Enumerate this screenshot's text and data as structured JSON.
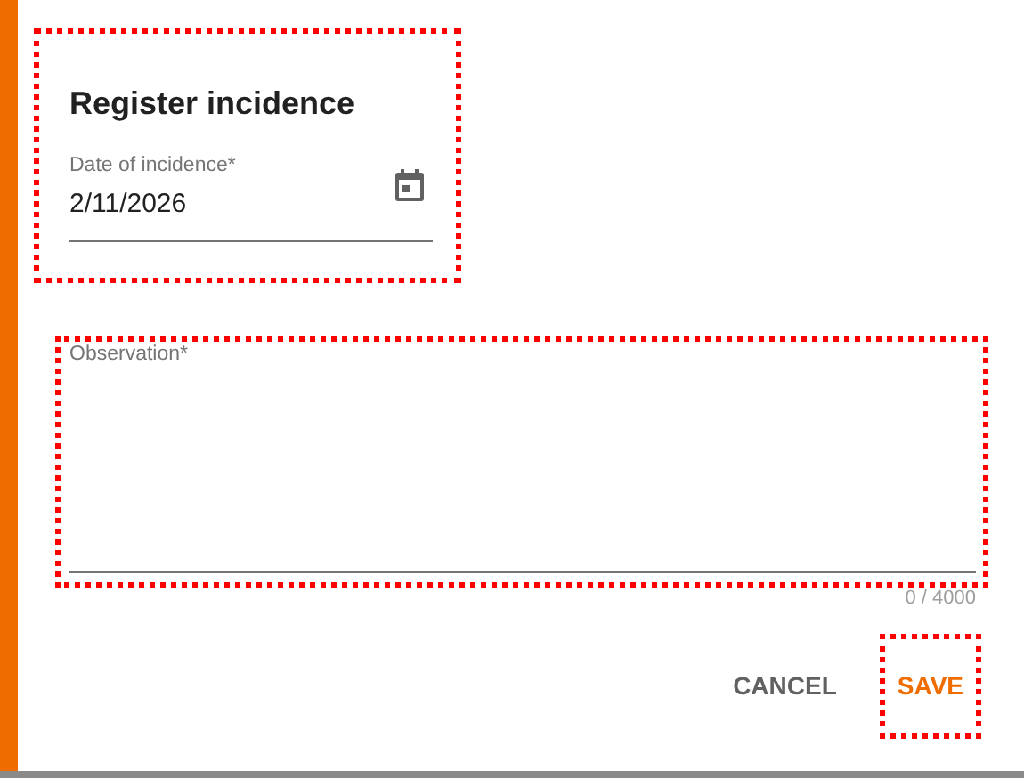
{
  "dialog": {
    "title": "Register incidence",
    "title_highlighted": true
  },
  "date_field": {
    "label": "Date of incidence*",
    "value": "2/11/2026"
  },
  "observation_field": {
    "label": "Observation*",
    "counter": "0 / 4000",
    "highlighted": true
  },
  "buttons": [
    {
      "label": "CANCEL",
      "kind": "secondary",
      "highlighted": false
    },
    {
      "label": "SAVE",
      "kind": "primary",
      "highlighted": true
    }
  ]
}
